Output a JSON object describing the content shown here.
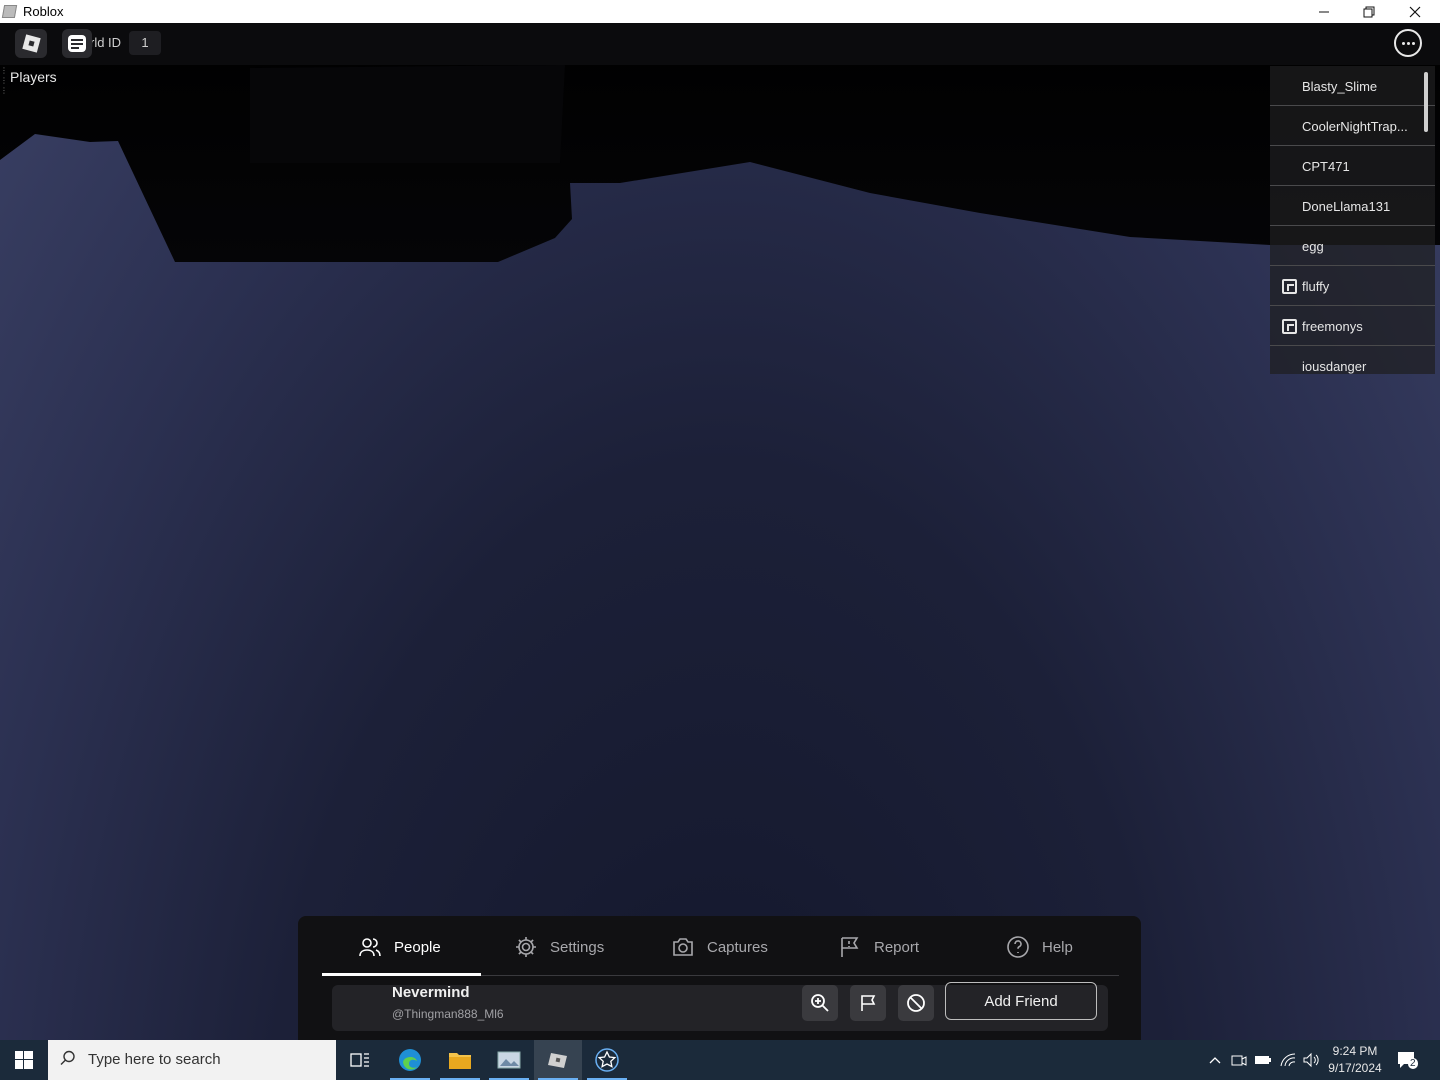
{
  "window": {
    "title": "Roblox",
    "controls": {
      "minimize": "—",
      "restore": "❐",
      "close": "✕"
    }
  },
  "topbar": {
    "world_label": "rld ID",
    "world_value": "1"
  },
  "players_label": "Players",
  "player_list": [
    {
      "name": "Blasty_Slime",
      "premium": false
    },
    {
      "name": "CoolerNightTrap...",
      "premium": false
    },
    {
      "name": "CPT471",
      "premium": false
    },
    {
      "name": "DoneLlama131",
      "premium": false
    },
    {
      "name": "egg",
      "premium": false
    },
    {
      "name": "fluffy",
      "premium": true
    },
    {
      "name": "freemonys",
      "premium": true
    },
    {
      "name": "iousdanger",
      "premium": false
    }
  ],
  "menu": {
    "tabs": [
      {
        "label": "People",
        "icon": "people-icon",
        "active": true
      },
      {
        "label": "Settings",
        "icon": "gear-icon",
        "active": false
      },
      {
        "label": "Captures",
        "icon": "camera-icon",
        "active": false
      },
      {
        "label": "Report",
        "icon": "flag-icon",
        "active": false
      },
      {
        "label": "Help",
        "icon": "help-icon",
        "active": false
      }
    ],
    "person": {
      "display_name": "Nevermind",
      "username": "@Thingman888_Ml6",
      "add_friend_label": "Add Friend"
    }
  },
  "taskbar": {
    "search_placeholder": "Type here to search",
    "time": "9:24 PM",
    "date": "9/17/2024",
    "notification_count": "2",
    "accent": "#6ab0f3"
  }
}
